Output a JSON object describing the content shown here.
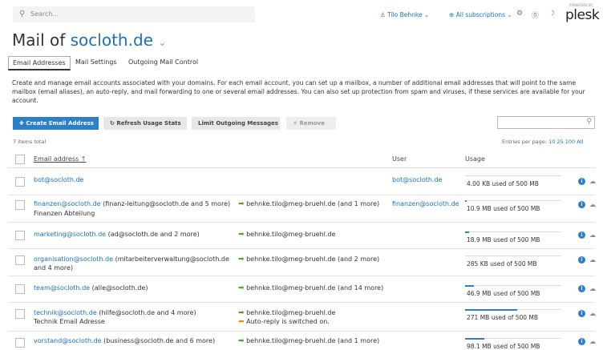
{
  "topbar": {
    "search_placeholder": "Search...",
    "user_name": "Tilo Behnke",
    "subscriptions": "All subscriptions",
    "brand_small": "POWERED BY",
    "brand": "plesk"
  },
  "page": {
    "title_prefix": "Mail of",
    "domain": "socloth.de"
  },
  "tabs": [
    {
      "label": "Email Addresses",
      "active": true
    },
    {
      "label": "Mail Settings",
      "active": false
    },
    {
      "label": "Outgoing Mail Control",
      "active": false
    }
  ],
  "description": "Create and manage email accounts associated with your domains. For each email account, you can set up a mailbox, a number of additional email addresses that will point to the same mailbox (email aliases), an auto-reply, and mail forwarding to one or several email addresses. You can also set up protection from spam and viruses, if these services are available for your account.",
  "toolbar": {
    "create": "Create Email Address",
    "refresh": "Refresh Usage Stats",
    "limit": "Limit Outgoing Messages",
    "remove": "Remove"
  },
  "list": {
    "total": "7 items total",
    "per_page_label": "Entries per page:",
    "per_page_options": "10 25 100 All",
    "col_email": "Email address",
    "col_email_sort": "↑",
    "col_user": "User",
    "col_usage": "Usage"
  },
  "rows": [
    {
      "email": "bot@socloth.de",
      "extra": "",
      "subtitle": "",
      "forward": "",
      "forward2": "",
      "user": "bot@socloth.de",
      "usage": "4.00 KB used of 500 MB",
      "usage_fraction": 0.0
    },
    {
      "email": "finanzen@socloth.de",
      "extra": "(finanz-leitung@socloth.de and 5 more)",
      "subtitle": "Finanzen Abteilung",
      "forward": "behnke.tilo@meg-bruehl.de (and 1 more)",
      "forward2": "",
      "user": "finanzen@socloth.de",
      "usage": "10.9 MB used of 500 MB",
      "usage_fraction": 0.02
    },
    {
      "email": "marketing@socloth.de",
      "extra": "(ad@socloth.de and 2 more)",
      "subtitle": "",
      "forward": "behnke.tilo@meg-bruehl.de",
      "forward2": "",
      "user": "",
      "usage": "18.9 MB used of 500 MB",
      "usage_fraction": 0.04
    },
    {
      "email": "organisation@socloth.de",
      "extra": "(mitarbeiterverwaltung@socloth.de",
      "subtitle": "and 4 more)",
      "forward": "behnke.tilo@meg-bruehl.de (and 2 more)",
      "forward2": "",
      "user": "",
      "usage": "285 KB used of 500 MB",
      "usage_fraction": 0.0
    },
    {
      "email": "team@socloth.de",
      "extra": "(alle@socloth.de)",
      "subtitle": "",
      "forward": "behnke.tilo@meg-bruehl.de (and 14 more)",
      "forward2": "",
      "user": "",
      "usage": "46.9 MB used of 500 MB",
      "usage_fraction": 0.09
    },
    {
      "email": "technik@socloth.de",
      "extra": "(hilfe@socloth.de and 4 more)",
      "subtitle": "Technik Email Adresse",
      "forward": "behnke.tilo@meg-bruehl.de",
      "forward2": "Auto-reply is switched on.",
      "user": "",
      "usage": "271 MB used of 500 MB",
      "usage_fraction": 0.54
    },
    {
      "email": "vorstand@socloth.de",
      "extra": "(business@socloth.de and 6 more)",
      "subtitle": "",
      "forward": "behnke.tilo@meg-bruehl.de (and 1 more)",
      "forward2": "",
      "user": "",
      "usage": "98.1 MB used of 500 MB",
      "usage_fraction": 0.2
    }
  ]
}
